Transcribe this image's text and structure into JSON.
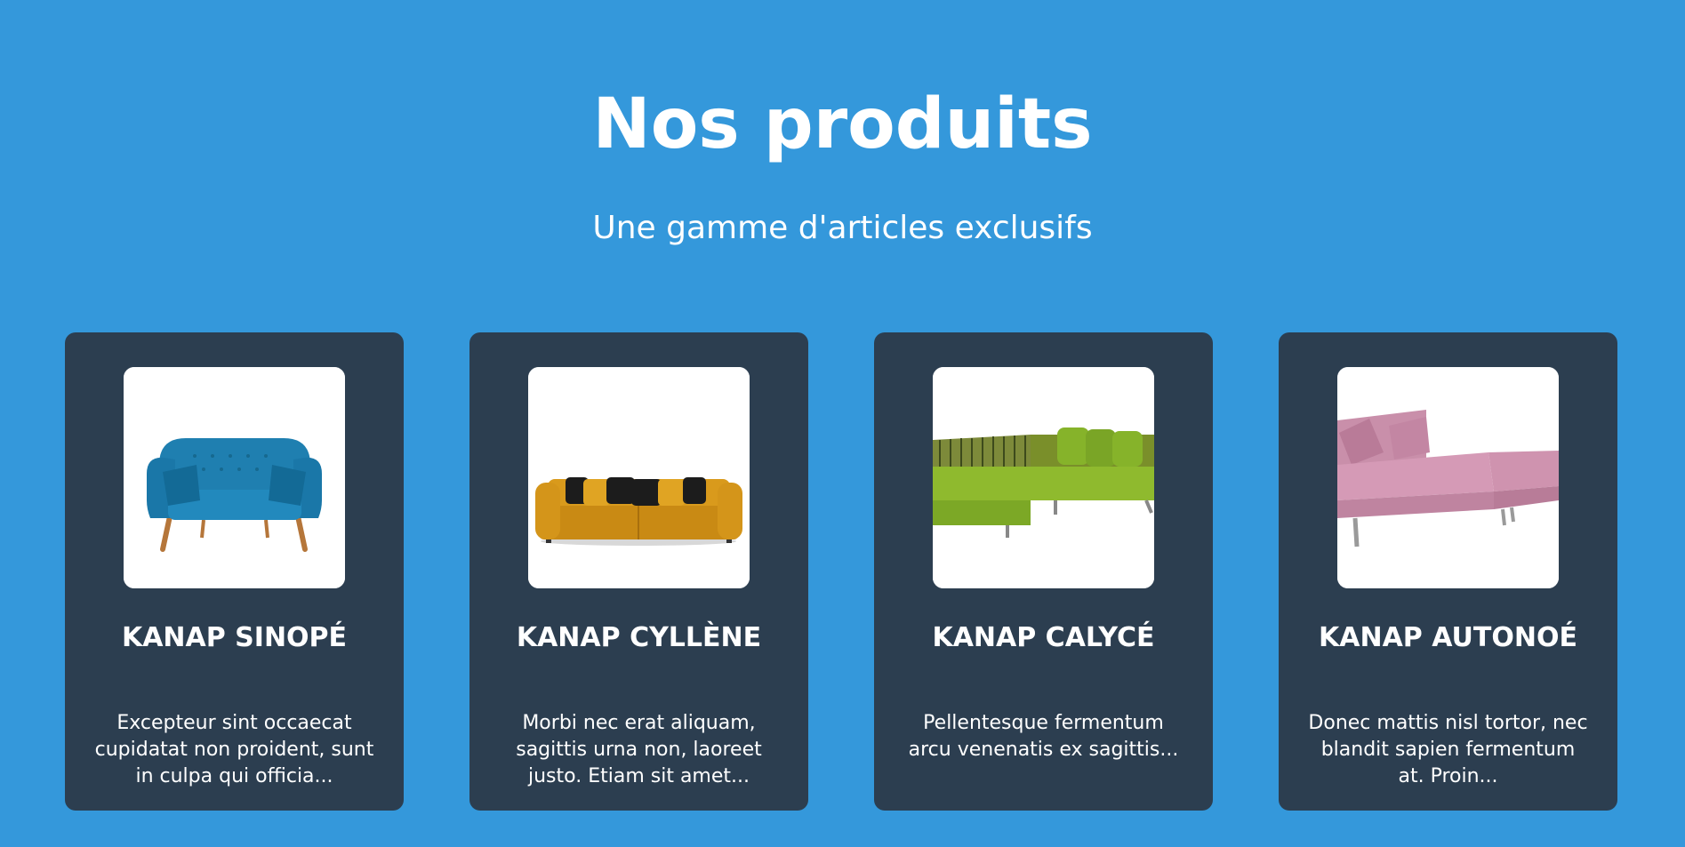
{
  "section": {
    "title": "Nos produits",
    "subtitle": "Une gamme d'articles exclusifs"
  },
  "products": [
    {
      "name": "KANAP SINOPÉ",
      "description": "Excepteur sint occaecat cupidatat non proident, sunt in culpa qui officia...",
      "image_icon": "blue-sofa-image"
    },
    {
      "name": "KANAP CYLLÈNE",
      "description": "Morbi nec erat aliquam, sagittis urna non, laoreet justo. Etiam sit amet...",
      "image_icon": "yellow-sofa-image"
    },
    {
      "name": "KANAP CALYCÉ",
      "description": "Pellentesque fermentum arcu venenatis ex sagittis...",
      "image_icon": "green-corner-sofa-image"
    },
    {
      "name": "KANAP AUTONOÉ",
      "description": "Donec mattis nisl tortor, nec blandit sapien fermentum at. Proin...",
      "image_icon": "pink-sofa-bed-image"
    }
  ],
  "colors": {
    "background": "#3498db",
    "card": "#2c3e50",
    "text": "#ffffff"
  }
}
